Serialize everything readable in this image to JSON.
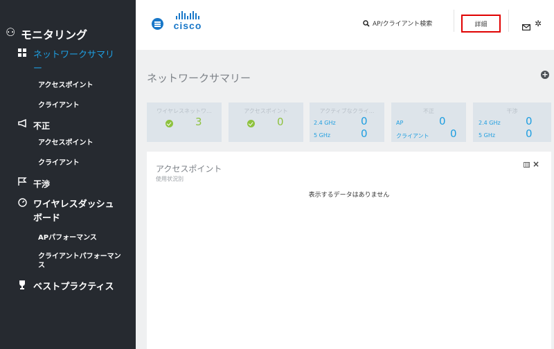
{
  "sidebar": {
    "monitoring": "モニタリング",
    "network_summary": "ネットワークサマリー",
    "access_point": "アクセスポイント",
    "client": "クライアント",
    "rogue": "不正",
    "rogue_access_point": "アクセスポイント",
    "rogue_client": "クライアント",
    "interference": "干渉",
    "wireless_dashboard": "ワイヤレスダッシュボード",
    "ap_performance": "APパフォーマンス",
    "client_performance": "クライアントパフォーマンス",
    "best_practices": "ベストプラクティス"
  },
  "header": {
    "logo_text": "cisco",
    "search_label": "AP/クライアント検索",
    "detail_button": "詳細"
  },
  "main": {
    "page_title": "ネットワークサマリー",
    "cards": {
      "wireless_network": {
        "title": "ワイヤレスネットワ...",
        "value": "3"
      },
      "access_points": {
        "title": "アクセスポイント",
        "value": "0"
      },
      "active_clients": {
        "title": "アクティブなクライ...",
        "label1": "2.4 GHz",
        "value1": "0",
        "label2": "5 GHz",
        "value2": "0"
      },
      "rogue": {
        "title": "不正",
        "label1": "AP",
        "value1": "0",
        "label2": "クライアント",
        "value2": "0"
      },
      "interference": {
        "title": "干渉",
        "label1": "2.4 GHz",
        "value1": "0",
        "label2": "5 GHz",
        "value2": "0"
      }
    },
    "panel": {
      "title": "アクセスポイント",
      "subtitle": "使用状況別",
      "empty_message": "表示するデータはありません"
    }
  },
  "colors": {
    "sidebar_bg": "#262a30",
    "accent_blue": "#1e9ee0",
    "ok_green": "#8ec23f",
    "highlight_red": "#e00000"
  }
}
